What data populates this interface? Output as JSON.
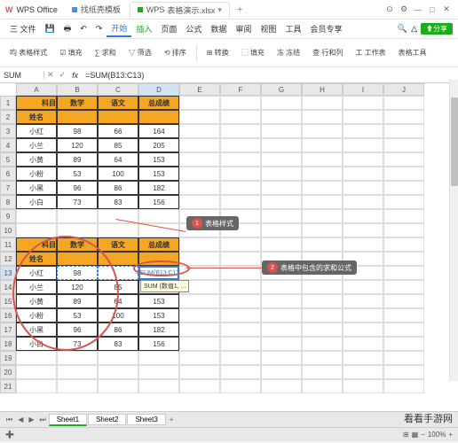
{
  "titlebar": {
    "app_logo": "W",
    "app_name": "WPS Office",
    "tab1": "找纸壳模板",
    "tab2": "WPS",
    "tab2_file": "表格演示.xlsx",
    "tab_add": "+"
  },
  "menu": {
    "items": [
      "三 文件",
      "日",
      "初日",
      "凸",
      "口",
      "♡",
      "↶",
      "↷"
    ],
    "main": [
      "开始",
      "插入",
      "页面",
      "公式",
      "数据",
      "审阅",
      "视图",
      "工具",
      "会员专享"
    ],
    "active": "开始",
    "search": "🔍",
    "share": "⬆分享"
  },
  "ribbon": {
    "items": [
      "呁 表格样式",
      "☑ 填充",
      "∑ 求和",
      "▽ 筛选",
      "⟲ 排序",
      "⊞ 转换",
      "⬚ 填充",
      "冻 冻结",
      "查 行和列",
      "工 工作表",
      "表格工具"
    ]
  },
  "formula_bar": {
    "name_box": "SUM",
    "fx": "fx",
    "formula": "=SUM(B13:C13)"
  },
  "columns": [
    "A",
    "B",
    "C",
    "D",
    "E",
    "F",
    "G",
    "H",
    "I",
    "J"
  ],
  "table1": {
    "headers": {
      "corner": "科目",
      "name": "姓名",
      "c1": "数学",
      "c2": "语文",
      "c3": "总成绩"
    },
    "rows": [
      {
        "n": "小红",
        "a": "98",
        "b": "66",
        "c": "164"
      },
      {
        "n": "小兰",
        "a": "120",
        "b": "85",
        "c": "205"
      },
      {
        "n": "小黄",
        "a": "89",
        "b": "64",
        "c": "153"
      },
      {
        "n": "小粉",
        "a": "53",
        "b": "100",
        "c": "153"
      },
      {
        "n": "小黑",
        "a": "96",
        "b": "86",
        "c": "182"
      },
      {
        "n": "小白",
        "a": "73",
        "b": "83",
        "c": "156"
      }
    ]
  },
  "table2": {
    "headers": {
      "corner": "科目",
      "name": "姓名",
      "c1": "数学",
      "c2": "语文",
      "c3": "总成绩"
    },
    "rows": [
      {
        "n": "小红",
        "a": "98",
        "b": "",
        "c": "=SUM(B13:C13)"
      },
      {
        "n": "小兰",
        "a": "120",
        "b": "85",
        "c": ""
      },
      {
        "n": "小黄",
        "a": "89",
        "b": "64",
        "c": "153"
      },
      {
        "n": "小粉",
        "a": "53",
        "b": "100",
        "c": "153"
      },
      {
        "n": "小黑",
        "a": "96",
        "b": "86",
        "c": "182"
      },
      {
        "n": "小白",
        "a": "73",
        "b": "83",
        "c": "156"
      }
    ]
  },
  "annotations": {
    "a1_num": "1",
    "a1_text": "表格样式",
    "a2_num": "2",
    "a2_text": "表格中包含的求和公式"
  },
  "tooltip": "SUM (数值1, ...",
  "sheets": {
    "s1": "Sheet1",
    "s2": "Sheet2",
    "s3": "Sheet3",
    "add": "+"
  },
  "status": {
    "left": "➕",
    "zoom": "100%"
  },
  "watermark": "看看手游网"
}
